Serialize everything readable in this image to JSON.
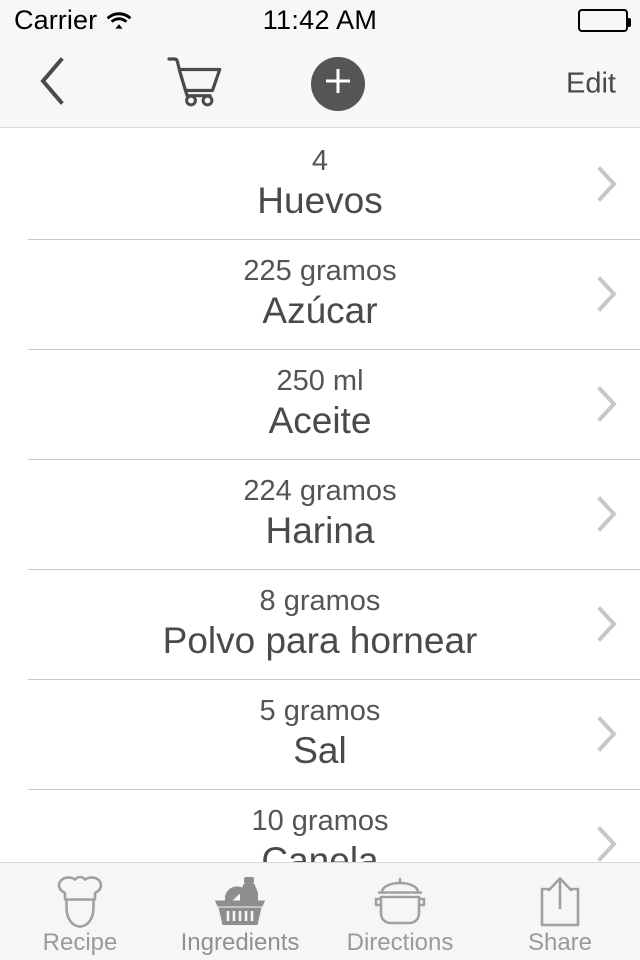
{
  "status_bar": {
    "carrier": "Carrier",
    "wifi_icon": "wifi-icon",
    "time": "11:42 AM",
    "battery_icon": "battery-full-icon"
  },
  "nav_bar": {
    "back_icon": "chevron-left-icon",
    "cart_icon": "shopping-cart-icon",
    "add_icon": "plus-icon",
    "edit_label": "Edit"
  },
  "ingredients": [
    {
      "quantity": "4",
      "name": "Huevos",
      "disclosure_icon": "chevron-right-icon"
    },
    {
      "quantity": "225 gramos",
      "name": "Azúcar",
      "disclosure_icon": "chevron-right-icon"
    },
    {
      "quantity": "250 ml",
      "name": "Aceite",
      "disclosure_icon": "chevron-right-icon"
    },
    {
      "quantity": "224 gramos",
      "name": "Harina",
      "disclosure_icon": "chevron-right-icon"
    },
    {
      "quantity": "8 gramos",
      "name": "Polvo para hornear",
      "disclosure_icon": "chevron-right-icon"
    },
    {
      "quantity": "5 gramos",
      "name": "Sal",
      "disclosure_icon": "chevron-right-icon"
    },
    {
      "quantity": "10 gramos",
      "name": "Canela",
      "disclosure_icon": "chevron-right-icon"
    }
  ],
  "tab_bar": {
    "tabs": [
      {
        "label": "Recipe",
        "icon": "chef-hat-icon",
        "selected": false
      },
      {
        "label": "Ingredients",
        "icon": "basket-icon",
        "selected": true
      },
      {
        "label": "Directions",
        "icon": "cooking-pot-icon",
        "selected": false
      },
      {
        "label": "Share",
        "icon": "share-icon",
        "selected": false
      }
    ]
  },
  "colors": {
    "bar_background": "#f7f7f7",
    "content_background": "#ffffff",
    "primary_text": "#4a4a4a",
    "secondary_text": "#555555",
    "separator": "#c8c8c8",
    "chevron": "#c7c7c7",
    "add_button": "#555555",
    "tab_inactive": "#9a9a9a"
  }
}
